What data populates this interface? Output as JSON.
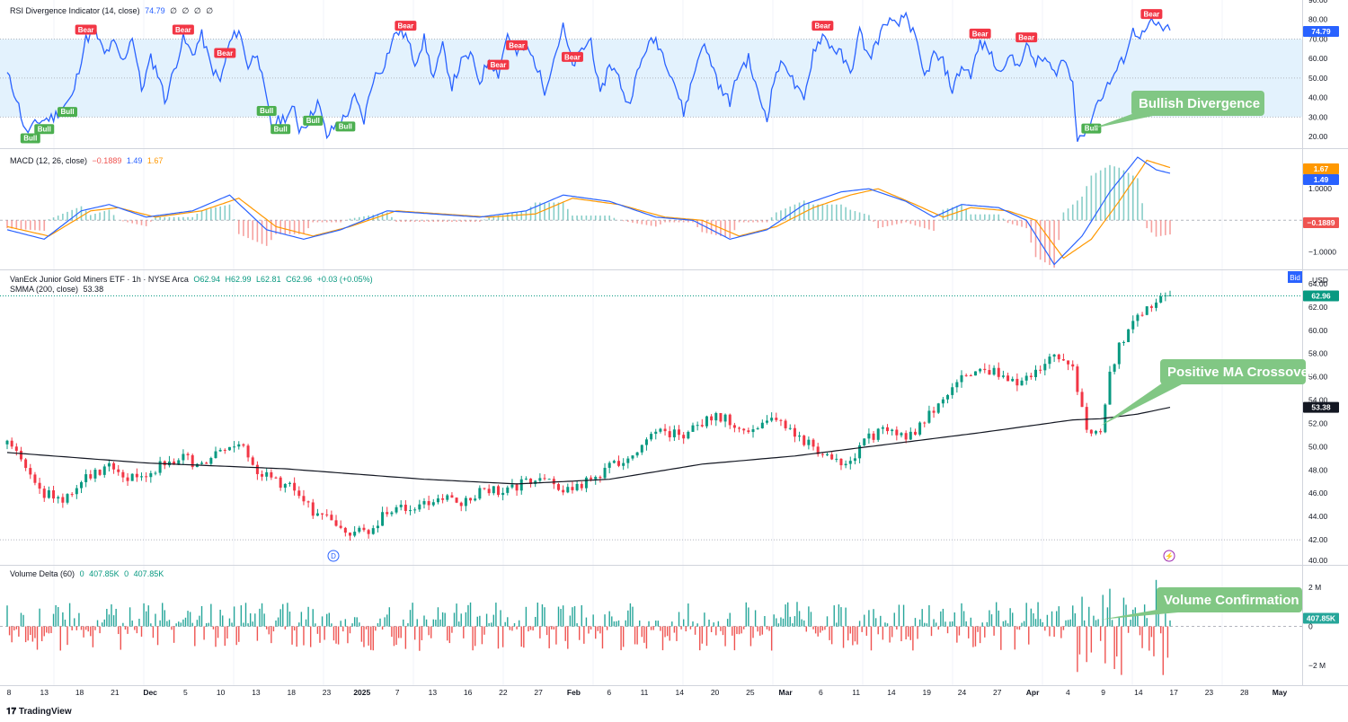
{
  "colors": {
    "rsi_line": "#2962ff",
    "rsi_band": "#e3f2fd",
    "bear": "#f23645",
    "bull": "#4caf50",
    "macd_line": "#2962ff",
    "signal_line": "#ff9800",
    "hist_up": "#26a69a",
    "hist_down": "#ef5350",
    "candle_up": "#089981",
    "candle_down": "#f23645",
    "smma": "#131722",
    "callout": "#81c784",
    "grid": "#f0f3fa"
  },
  "branding": {
    "logo": "TradingView"
  },
  "chart_data": [
    {
      "type": "line",
      "title": "RSI Divergence Indicator (14, close)",
      "value_label": "74.79",
      "extra_values": [
        "∅",
        "∅",
        "∅",
        "∅"
      ],
      "ylim": [
        15,
        90
      ],
      "y_ticks": [
        "20.00",
        "30.00",
        "40.00",
        "50.00",
        "60.00",
        "70.00",
        "80.00",
        "90.00"
      ],
      "bands": {
        "upper": 70,
        "lower": 30,
        "mid": 50
      },
      "last_value": "74.79",
      "anchors": [
        [
          0,
          52
        ],
        [
          2,
          40
        ],
        [
          4,
          22
        ],
        [
          7,
          28
        ],
        [
          10,
          30
        ],
        [
          14,
          40
        ],
        [
          17,
          70
        ],
        [
          19,
          74
        ],
        [
          21,
          62
        ],
        [
          23,
          68
        ],
        [
          25,
          58
        ],
        [
          27,
          72
        ],
        [
          29,
          44
        ],
        [
          31,
          60
        ],
        [
          33,
          50
        ],
        [
          34,
          38
        ],
        [
          36,
          54
        ],
        [
          38,
          70
        ],
        [
          40,
          62
        ],
        [
          42,
          72
        ],
        [
          44,
          56
        ],
        [
          46,
          48
        ],
        [
          48,
          68
        ],
        [
          50,
          75
        ],
        [
          52,
          56
        ],
        [
          54,
          64
        ],
        [
          55,
          50
        ],
        [
          57,
          26
        ],
        [
          60,
          30
        ],
        [
          62,
          34
        ],
        [
          63,
          24
        ],
        [
          65,
          28
        ],
        [
          67,
          38
        ],
        [
          69,
          20
        ],
        [
          71,
          26
        ],
        [
          73,
          30
        ],
        [
          75,
          40
        ],
        [
          77,
          28
        ],
        [
          79,
          50
        ],
        [
          81,
          55
        ],
        [
          83,
          68
        ],
        [
          84,
          74
        ],
        [
          86,
          72
        ],
        [
          88,
          58
        ],
        [
          90,
          70
        ],
        [
          92,
          50
        ],
        [
          94,
          66
        ],
        [
          96,
          46
        ],
        [
          98,
          58
        ],
        [
          100,
          62
        ],
        [
          102,
          48
        ],
        [
          104,
          60
        ],
        [
          106,
          52
        ],
        [
          108,
          73
        ],
        [
          110,
          62
        ],
        [
          112,
          66
        ],
        [
          114,
          58
        ],
        [
          116,
          44
        ],
        [
          118,
          60
        ],
        [
          120,
          76
        ],
        [
          122,
          56
        ],
        [
          124,
          64
        ],
        [
          126,
          70
        ],
        [
          128,
          40
        ],
        [
          130,
          58
        ],
        [
          132,
          50
        ],
        [
          134,
          36
        ],
        [
          136,
          52
        ],
        [
          138,
          66
        ],
        [
          140,
          70
        ],
        [
          142,
          60
        ],
        [
          144,
          48
        ],
        [
          146,
          32
        ],
        [
          148,
          50
        ],
        [
          150,
          68
        ],
        [
          152,
          58
        ],
        [
          154,
          44
        ],
        [
          156,
          38
        ],
        [
          158,
          54
        ],
        [
          160,
          60
        ],
        [
          162,
          42
        ],
        [
          164,
          30
        ],
        [
          166,
          54
        ],
        [
          168,
          58
        ],
        [
          170,
          46
        ],
        [
          172,
          38
        ],
        [
          174,
          64
        ],
        [
          176,
          72
        ],
        [
          178,
          66
        ],
        [
          180,
          62
        ],
        [
          182,
          52
        ],
        [
          184,
          74
        ],
        [
          186,
          60
        ],
        [
          188,
          70
        ],
        [
          190,
          80
        ],
        [
          192,
          76
        ],
        [
          194,
          83
        ],
        [
          196,
          70
        ],
        [
          198,
          50
        ],
        [
          200,
          62
        ],
        [
          202,
          58
        ],
        [
          204,
          44
        ],
        [
          206,
          56
        ],
        [
          208,
          52
        ],
        [
          210,
          68
        ],
        [
          212,
          64
        ],
        [
          214,
          52
        ],
        [
          216,
          62
        ],
        [
          218,
          56
        ],
        [
          220,
          66
        ],
        [
          222,
          58
        ],
        [
          224,
          60
        ],
        [
          226,
          52
        ],
        [
          228,
          60
        ],
        [
          230,
          48
        ],
        [
          231,
          20
        ],
        [
          233,
          22
        ],
        [
          235,
          36
        ],
        [
          237,
          44
        ],
        [
          239,
          52
        ],
        [
          241,
          60
        ],
        [
          243,
          74
        ],
        [
          245,
          72
        ],
        [
          247,
          78
        ],
        [
          249,
          76
        ],
        [
          251,
          74
        ]
      ],
      "bear_labels": [
        [
          17,
          "Bear"
        ],
        [
          38,
          "Bear"
        ],
        [
          47,
          "Bear"
        ],
        [
          86,
          "Bear"
        ],
        [
          106,
          "Bear"
        ],
        [
          110,
          "Bear"
        ],
        [
          122,
          "Bear"
        ],
        [
          176,
          "Bear"
        ],
        [
          210,
          "Bear"
        ],
        [
          220,
          "Bear"
        ],
        [
          247,
          "Bear"
        ]
      ],
      "bull_labels": [
        [
          5,
          "Bull"
        ],
        [
          8,
          "Bull"
        ],
        [
          13,
          "Bull"
        ],
        [
          56,
          "Bull"
        ],
        [
          59,
          "Bull"
        ],
        [
          66,
          "Bull"
        ],
        [
          73,
          "Bull"
        ],
        [
          234,
          "Bull"
        ]
      ],
      "annotation": "Bullish Divergence"
    },
    {
      "type": "line",
      "title": "MACD (12, 26, close)",
      "values_shown": [
        "−0.1889",
        "1.49",
        "1.67"
      ],
      "ylim": [
        -1.5,
        2.2
      ],
      "y_ticks": [
        "1.0000",
        "−1.0000"
      ],
      "last_values": {
        "signal": "1.67",
        "macd": "1.49",
        "hist": "−0.1889"
      },
      "macd_anchors": [
        [
          0,
          -0.3
        ],
        [
          8,
          -0.6
        ],
        [
          16,
          0.3
        ],
        [
          22,
          0.5
        ],
        [
          30,
          0.1
        ],
        [
          40,
          0.3
        ],
        [
          48,
          0.8
        ],
        [
          56,
          -0.3
        ],
        [
          64,
          -0.6
        ],
        [
          72,
          -0.3
        ],
        [
          82,
          0.3
        ],
        [
          92,
          0.2
        ],
        [
          102,
          0.1
        ],
        [
          112,
          0.3
        ],
        [
          120,
          0.8
        ],
        [
          130,
          0.6
        ],
        [
          140,
          0.1
        ],
        [
          148,
          0.0
        ],
        [
          156,
          -0.6
        ],
        [
          164,
          -0.3
        ],
        [
          172,
          0.5
        ],
        [
          180,
          0.9
        ],
        [
          186,
          1.0
        ],
        [
          194,
          0.6
        ],
        [
          200,
          0.1
        ],
        [
          206,
          0.5
        ],
        [
          214,
          0.4
        ],
        [
          220,
          0.0
        ],
        [
          226,
          -1.4
        ],
        [
          232,
          -0.5
        ],
        [
          238,
          0.9
        ],
        [
          244,
          2.0
        ],
        [
          248,
          1.6
        ],
        [
          251,
          1.49
        ]
      ],
      "signal_anchors": [
        [
          0,
          -0.2
        ],
        [
          9,
          -0.5
        ],
        [
          18,
          0.3
        ],
        [
          24,
          0.4
        ],
        [
          32,
          0.1
        ],
        [
          42,
          0.3
        ],
        [
          50,
          0.7
        ],
        [
          58,
          -0.2
        ],
        [
          66,
          -0.5
        ],
        [
          74,
          -0.2
        ],
        [
          84,
          0.3
        ],
        [
          94,
          0.2
        ],
        [
          104,
          0.1
        ],
        [
          114,
          0.2
        ],
        [
          122,
          0.7
        ],
        [
          132,
          0.5
        ],
        [
          142,
          0.1
        ],
        [
          150,
          0.0
        ],
        [
          158,
          -0.5
        ],
        [
          166,
          -0.2
        ],
        [
          174,
          0.4
        ],
        [
          182,
          0.8
        ],
        [
          188,
          1.0
        ],
        [
          196,
          0.5
        ],
        [
          202,
          0.1
        ],
        [
          208,
          0.4
        ],
        [
          216,
          0.3
        ],
        [
          222,
          0.0
        ],
        [
          228,
          -1.2
        ],
        [
          234,
          -0.6
        ],
        [
          240,
          0.6
        ],
        [
          246,
          1.9
        ],
        [
          251,
          1.67
        ]
      ]
    },
    {
      "type": "candlestick",
      "title": "VanEck Junior Gold Miners ETF · 1h · NYSE Arca",
      "ohlc": {
        "O": "62.94",
        "H": "62.99",
        "L": "62.81",
        "C": "62.96",
        "change": "+0.03 (+0.05%)"
      },
      "ma_label": "SMMA (200, close)",
      "ma_value": "53.38",
      "currency": "USD",
      "bid_label": "Bid",
      "ylim": [
        40,
        65
      ],
      "y_ticks": [
        "42.00",
        "44.00",
        "46.00",
        "48.00",
        "50.00",
        "52.00",
        "54.00",
        "56.00",
        "58.00",
        "60.00",
        "62.00",
        "64.00"
      ],
      "last_price": "62.96",
      "price_anchors": [
        [
          0,
          50.2
        ],
        [
          4,
          48.5
        ],
        [
          8,
          46.0
        ],
        [
          12,
          45.4
        ],
        [
          16,
          47.0
        ],
        [
          20,
          47.8
        ],
        [
          22,
          48.6
        ],
        [
          26,
          47.3
        ],
        [
          30,
          47.6
        ],
        [
          34,
          48.6
        ],
        [
          38,
          49.0
        ],
        [
          42,
          48.3
        ],
        [
          46,
          49.5
        ],
        [
          50,
          50.4
        ],
        [
          54,
          48.0
        ],
        [
          58,
          47.0
        ],
        [
          62,
          46.4
        ],
        [
          66,
          44.5
        ],
        [
          70,
          43.5
        ],
        [
          74,
          42.8
        ],
        [
          78,
          42.4
        ],
        [
          82,
          44.5
        ],
        [
          86,
          44.6
        ],
        [
          90,
          45.0
        ],
        [
          94,
          45.6
        ],
        [
          98,
          45.0
        ],
        [
          102,
          46.2
        ],
        [
          106,
          46.2
        ],
        [
          110,
          46.6
        ],
        [
          114,
          47.2
        ],
        [
          118,
          46.7
        ],
        [
          122,
          46.3
        ],
        [
          126,
          47.1
        ],
        [
          130,
          48.4
        ],
        [
          134,
          49.0
        ],
        [
          138,
          50.6
        ],
        [
          142,
          51.3
        ],
        [
          146,
          51.0
        ],
        [
          150,
          52.1
        ],
        [
          154,
          52.6
        ],
        [
          158,
          51.5
        ],
        [
          162,
          51.7
        ],
        [
          166,
          52.6
        ],
        [
          170,
          50.8
        ],
        [
          174,
          50.2
        ],
        [
          178,
          48.5
        ],
        [
          182,
          49.0
        ],
        [
          186,
          50.8
        ],
        [
          190,
          51.4
        ],
        [
          194,
          50.5
        ],
        [
          198,
          52.4
        ],
        [
          202,
          54.0
        ],
        [
          206,
          56.0
        ],
        [
          210,
          57.1
        ],
        [
          214,
          56.1
        ],
        [
          218,
          55.4
        ],
        [
          222,
          56.5
        ],
        [
          226,
          57.6
        ],
        [
          230,
          56.7
        ],
        [
          232,
          53.0
        ],
        [
          234,
          50.8
        ],
        [
          236,
          51.0
        ],
        [
          238,
          56.0
        ],
        [
          240,
          58.6
        ],
        [
          243,
          60.5
        ],
        [
          246,
          61.8
        ],
        [
          249,
          62.5
        ],
        [
          251,
          62.96
        ]
      ],
      "ma_anchors": [
        [
          0,
          49.5
        ],
        [
          30,
          48.6
        ],
        [
          60,
          48.1
        ],
        [
          90,
          47.2
        ],
        [
          110,
          46.8
        ],
        [
          130,
          47.2
        ],
        [
          150,
          48.5
        ],
        [
          170,
          49.2
        ],
        [
          190,
          50.2
        ],
        [
          210,
          51.2
        ],
        [
          230,
          52.3
        ],
        [
          236,
          52.4
        ],
        [
          244,
          52.8
        ],
        [
          251,
          53.38
        ]
      ],
      "annotation": "Positive MA Crossover",
      "markers": [
        "D",
        "⚡"
      ]
    },
    {
      "type": "bar",
      "title": "Volume Delta (60)",
      "values_shown": [
        "0",
        "407.85K",
        "0",
        "407.85K"
      ],
      "ylim": [
        -3,
        3
      ],
      "y_ticks": [
        "2 M",
        "0",
        "−2 M"
      ],
      "last_value": "407.85K",
      "annotation": "Volume Confirmation"
    }
  ],
  "x_axis": {
    "labels": [
      "8",
      "13",
      "18",
      "21",
      "Dec",
      "5",
      "10",
      "13",
      "18",
      "23",
      "2025",
      "7",
      "13",
      "16",
      "22",
      "27",
      "Feb",
      "6",
      "11",
      "14",
      "20",
      "25",
      "Mar",
      "6",
      "11",
      "14",
      "19",
      "24",
      "27",
      "Apr",
      "4",
      "9",
      "14",
      "17",
      "23",
      "28",
      "May"
    ],
    "bold_labels": [
      "Dec",
      "2025",
      "Feb",
      "Mar",
      "Apr",
      "May"
    ]
  }
}
